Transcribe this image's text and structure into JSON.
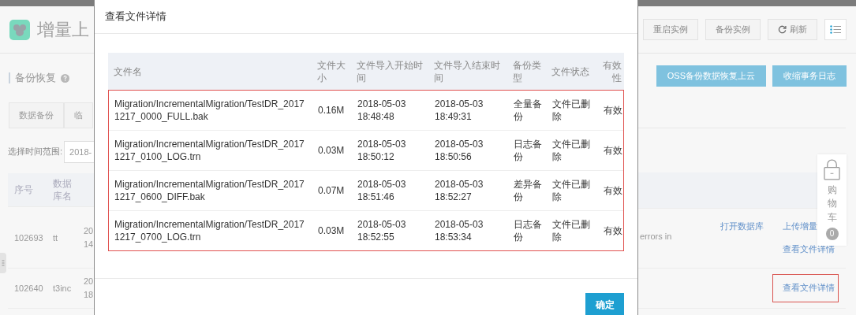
{
  "page": {
    "title": "增量上",
    "section_title": "备份恢复",
    "tabs": [
      {
        "label": "数据备份",
        "selected": false
      },
      {
        "label": "临",
        "selected": false
      }
    ],
    "time_range_label": "选择时间范围:",
    "time_range_value": "2018-",
    "toolbar_buttons": [
      {
        "label": "重启实例",
        "kind": "text"
      },
      {
        "label": "备份实例",
        "kind": "text"
      },
      {
        "label": "刷新",
        "kind": "refresh"
      },
      {
        "kind": "list"
      }
    ],
    "action_buttons": [
      "OSS备份数据恢复上云",
      "收缩事务日志"
    ],
    "table": {
      "columns": [
        "序号",
        "数据库名"
      ],
      "rows": [
        {
          "id": "102693",
          "database": "tt",
          "time": [
            "20",
            "14"
          ],
          "message": "errors in",
          "open_link": "打开数据库",
          "links": [
            {
              "label": "上传增量",
              "highlighted": false
            },
            {
              "label": "查看文件详情",
              "highlighted": false
            }
          ]
        },
        {
          "id": "102640",
          "database": "t3inc",
          "time": [
            "20",
            "18"
          ],
          "links": [
            {
              "label": "查看文件详情",
              "highlighted": true
            }
          ]
        }
      ]
    },
    "cart": {
      "label": "购物车",
      "count": "0"
    }
  },
  "dialog": {
    "title": "查看文件详情",
    "highlighted": true,
    "columns": [
      "文件名",
      "文件大小",
      "文件导入开始时间",
      "文件导入结束时间",
      "备份类型",
      "文件状态",
      "有效性"
    ],
    "rows": [
      [
        "Migration/IncrementalMigration/TestDR_20171217_0000_FULL.bak",
        "0.16M",
        "2018-05-03 18:48:48",
        "2018-05-03 18:49:31",
        "全量备份",
        "文件已删除",
        "有效"
      ],
      [
        "Migration/IncrementalMigration/TestDR_20171217_0100_LOG.trn",
        "0.03M",
        "2018-05-03 18:50:12",
        "2018-05-03 18:50:56",
        "日志备份",
        "文件已删除",
        "有效"
      ],
      [
        "Migration/IncrementalMigration/TestDR_20171217_0600_DIFF.bak",
        "0.07M",
        "2018-05-03 18:51:46",
        "2018-05-03 18:52:27",
        "差异备份",
        "文件已删除",
        "有效"
      ],
      [
        "Migration/IncrementalMigration/TestDR_20171217_0700_LOG.trn",
        "0.03M",
        "2018-05-03 18:52:55",
        "2018-05-03 18:53:34",
        "日志备份",
        "文件已删除",
        "有效"
      ]
    ],
    "confirm": "确定"
  }
}
